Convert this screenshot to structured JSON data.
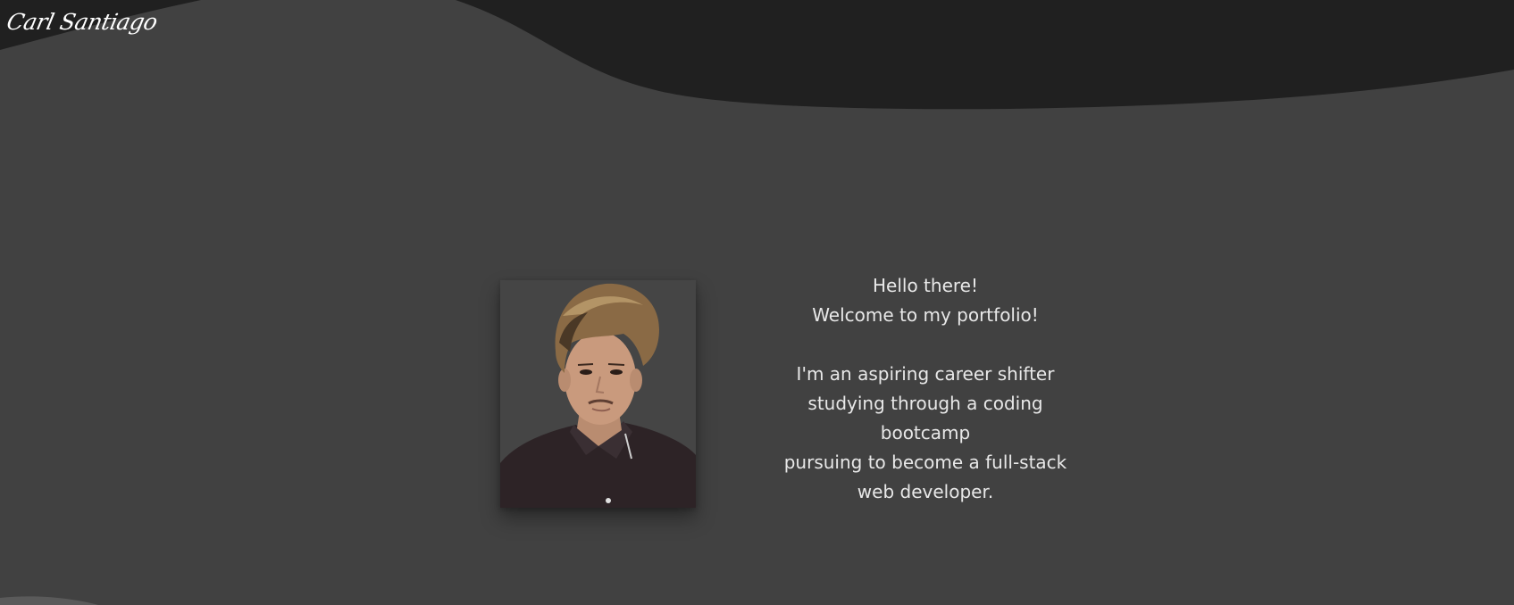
{
  "brand": {
    "logo_text": "Carl Santiago"
  },
  "hero": {
    "greeting": "Hello there!",
    "welcome": "Welcome to my portfolio!",
    "bio_line1": "I'm an aspiring career shifter",
    "bio_line2": "studying through a coding",
    "bio_line3": "bootcamp",
    "bio_line4": "pursuing to become a full-stack",
    "bio_line5": "web developer."
  },
  "colors": {
    "background": "#414141",
    "wave": "#202020",
    "text": "#e8e8e8"
  }
}
